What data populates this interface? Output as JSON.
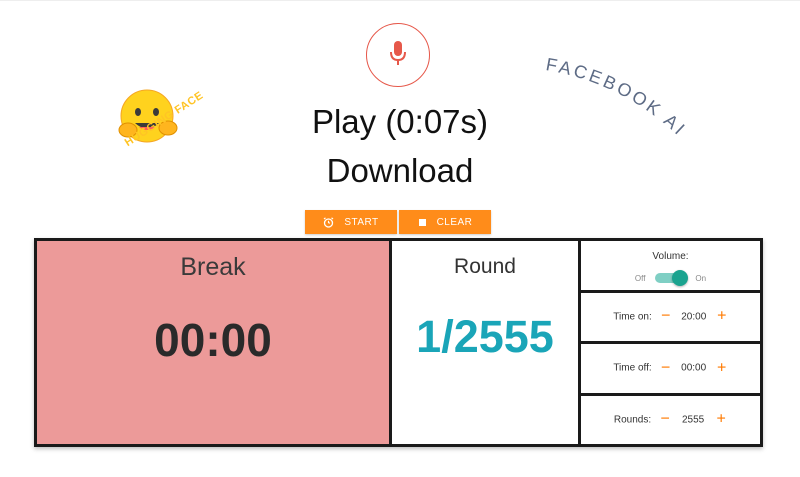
{
  "colors": {
    "accent": "#ff8c1a",
    "break_bg": "#ec9a99",
    "round_count": "#1aa5b8",
    "mic": "#e6584a",
    "toggle_on": "#1aa38f"
  },
  "header": {
    "play_label": "Play (0:07s)",
    "download_label": "Download"
  },
  "logos": {
    "hugging_face": "HUGGING FACE",
    "facebook_ai": "FACEBOOK AI"
  },
  "actions": {
    "start_label": "START",
    "clear_label": "CLEAR",
    "start_icon": "alarm-clock-icon",
    "clear_icon": "stop-square-icon"
  },
  "timer": {
    "phase_label": "Break",
    "time": "00:00",
    "round_label": "Round",
    "round_value": "1/2555"
  },
  "settings": {
    "volume": {
      "label": "Volume:",
      "off": "Off",
      "on": "On",
      "enabled": true
    },
    "time_on": {
      "label": "Time on:",
      "value": "20:00",
      "minus": "−",
      "plus": "+"
    },
    "time_off": {
      "label": "Time off:",
      "value": "00:00",
      "minus": "−",
      "plus": "+"
    },
    "rounds": {
      "label": "Rounds:",
      "value": "2555",
      "minus": "−",
      "plus": "+"
    }
  }
}
